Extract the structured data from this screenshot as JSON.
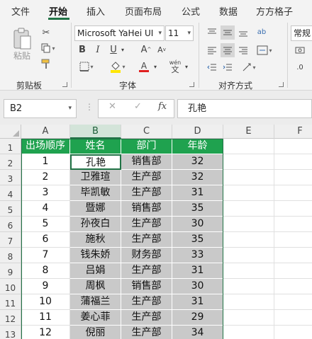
{
  "menu": {
    "tabs": [
      {
        "label": "文件"
      },
      {
        "label": "开始"
      },
      {
        "label": "插入"
      },
      {
        "label": "页面布局"
      },
      {
        "label": "公式"
      },
      {
        "label": "数据"
      },
      {
        "label": "方方格子"
      }
    ],
    "active_tab": "开始"
  },
  "ribbon": {
    "clipboard": {
      "paste_label": "粘贴",
      "group_label": "剪贴板"
    },
    "font": {
      "font_name": "Microsoft YaHei UI",
      "font_size": "11",
      "group_label": "字体",
      "bold": "B",
      "italic": "I",
      "underline": "U",
      "grow": "A",
      "shrink": "A",
      "phonetic_top": "wén",
      "phonetic_bottom": "文",
      "font_color_letter": "A",
      "font_color": "#e02020",
      "highlight_color": "#ffe600"
    },
    "alignment": {
      "group_label": "对齐方式",
      "wrap_glyph": "ab"
    },
    "number": {
      "format": "常规"
    }
  },
  "formula_bar": {
    "name_box": "B2",
    "fx_label": "fx",
    "cancel_glyph": "✕",
    "enter_glyph": "✓",
    "content": "孔艳"
  },
  "grid": {
    "columns": [
      "A",
      "B",
      "C",
      "D",
      "E",
      "F"
    ],
    "rows": [
      "1",
      "2",
      "3",
      "4",
      "5",
      "6",
      "7",
      "8",
      "9",
      "10",
      "11",
      "12",
      "13"
    ],
    "active_cell": "B2",
    "header_color": "#1fa24f",
    "shade_color": "#c9c9c9",
    "table_headers": [
      "出场顺序",
      "姓名",
      "部门",
      "年龄"
    ],
    "table_rows": [
      [
        "1",
        "孔艳",
        "销售部",
        "32"
      ],
      [
        "2",
        "卫雅瑄",
        "生产部",
        "32"
      ],
      [
        "3",
        "毕凯敏",
        "生产部",
        "31"
      ],
      [
        "4",
        "暨娜",
        "销售部",
        "35"
      ],
      [
        "5",
        "孙夜白",
        "生产部",
        "30"
      ],
      [
        "6",
        "施秋",
        "生产部",
        "35"
      ],
      [
        "7",
        "钱朱娇",
        "财务部",
        "33"
      ],
      [
        "8",
        "吕娟",
        "生产部",
        "31"
      ],
      [
        "9",
        "周枫",
        "销售部",
        "30"
      ],
      [
        "10",
        "蒲福兰",
        "生产部",
        "31"
      ],
      [
        "11",
        "姜心菲",
        "生产部",
        "29"
      ],
      [
        "12",
        "倪丽",
        "生产部",
        "34"
      ]
    ]
  }
}
